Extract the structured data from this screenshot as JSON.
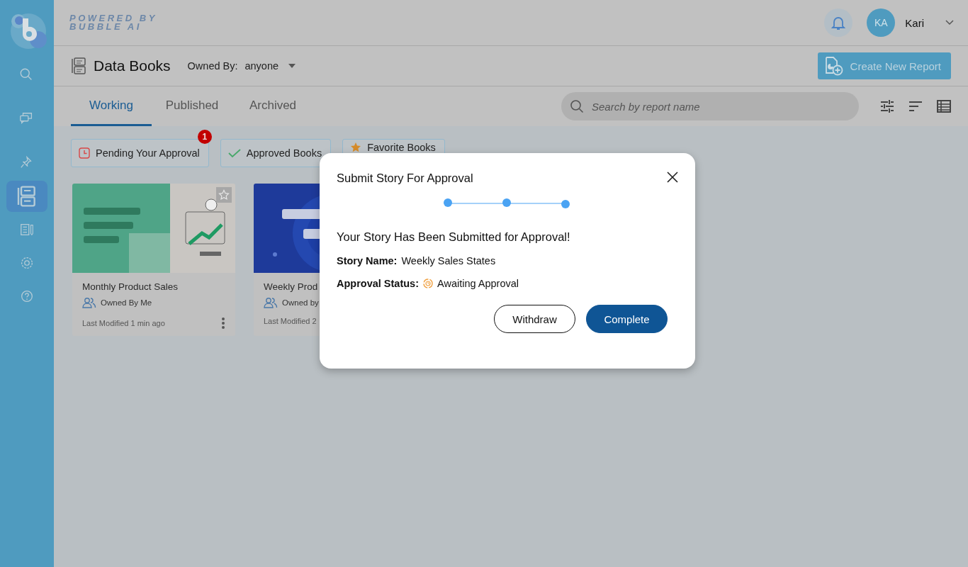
{
  "sidebar": {
    "items": [
      {
        "kind": "search",
        "selected": false
      },
      {
        "kind": "chat",
        "selected": false
      },
      {
        "kind": "pin",
        "selected": false
      },
      {
        "kind": "books",
        "selected": true
      },
      {
        "kind": "notes",
        "selected": false
      },
      {
        "kind": "settings",
        "selected": false
      },
      {
        "kind": "help",
        "selected": false
      }
    ]
  },
  "header": {
    "brand": [
      "POWERED BY",
      "BUBBLE AI"
    ],
    "user": {
      "initials": "KA",
      "name": "Kari"
    }
  },
  "page": {
    "title": "Data Books",
    "owner_label": "Owned By:",
    "owner_value": "anyone",
    "create_button": "Create New Report"
  },
  "tabs": [
    {
      "label": "Working",
      "selected": true
    },
    {
      "label": "Published",
      "selected": false
    },
    {
      "label": "Archived",
      "selected": false
    }
  ],
  "search": {
    "placeholder": "Search by report name"
  },
  "filters": [
    {
      "kind": "pending",
      "label": "Pending Your Approval",
      "badge": "1"
    },
    {
      "kind": "approved",
      "label": "Approved Books"
    },
    {
      "kind": "favorite",
      "label": "Favorite Books"
    }
  ],
  "cards": [
    {
      "title": "Monthly Product Sales",
      "owner": "Owned By Me",
      "modified": "Last Modified 1 min ago"
    },
    {
      "title": "Weekly Prod",
      "owner": "Owned by",
      "modified": "Last Modified 2"
    }
  ],
  "dialog": {
    "title": "Submit Story For Approval",
    "heading": "Your Story Has Been Submitted for Approval!",
    "fields": [
      {
        "kind": "text",
        "label": "Story Name:",
        "value": "Weekly Sales States"
      },
      {
        "kind": "status",
        "label": "Approval Status:",
        "value": "Awaiting Approval"
      }
    ],
    "buttons": [
      {
        "kind": "secondary",
        "label": "Withdraw"
      },
      {
        "kind": "primary",
        "label": "Complete"
      }
    ]
  }
}
